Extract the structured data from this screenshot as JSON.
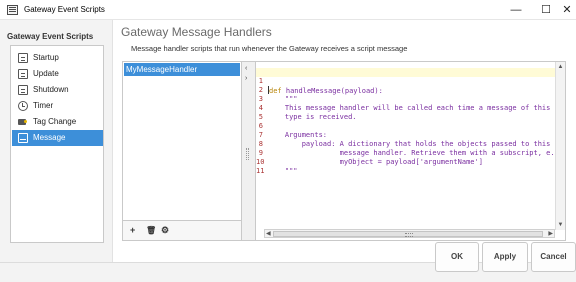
{
  "window": {
    "title": "Gateway Event Scripts",
    "minimize": "—",
    "maximize": "☐",
    "close": "✕"
  },
  "sidebar": {
    "heading": "Gateway Event Scripts",
    "items": [
      {
        "label": "Startup",
        "icon": "document-icon",
        "active": false
      },
      {
        "label": "Update",
        "icon": "document-icon",
        "active": false
      },
      {
        "label": "Shutdown",
        "icon": "document-icon",
        "active": false
      },
      {
        "label": "Timer",
        "icon": "clock-icon",
        "active": false
      },
      {
        "label": "Tag Change",
        "icon": "tag-icon",
        "active": false
      },
      {
        "label": "Message",
        "icon": "message-icon",
        "active": true
      }
    ]
  },
  "main": {
    "title": "Gateway Message Handlers",
    "description": "Message handler scripts that run whenever the Gateway receives a script message"
  },
  "handlers": {
    "items": [
      "MyMessageHandler"
    ],
    "toolbar": {
      "add": "+",
      "delete": "🗑",
      "settings": "⚙"
    }
  },
  "editor": {
    "lines": [
      {
        "n": "1",
        "keyword": "def",
        "text": " handleMessage(payload):"
      },
      {
        "n": "2",
        "keyword": "",
        "text": "    \"\"\""
      },
      {
        "n": "3",
        "keyword": "",
        "text": "    This message handler will be called each time a message of this"
      },
      {
        "n": "4",
        "keyword": "",
        "text": "    type is received."
      },
      {
        "n": "5",
        "keyword": "",
        "text": ""
      },
      {
        "n": "6",
        "keyword": "",
        "text": "    Arguments:"
      },
      {
        "n": "7",
        "keyword": "",
        "text": "        payload: A dictionary that holds the objects passed to this"
      },
      {
        "n": "8",
        "keyword": "",
        "text": "                 message handler. Retrieve them with a subscript, e.g."
      },
      {
        "n": "9",
        "keyword": "",
        "text": "                 myObject = payload['argumentName']"
      },
      {
        "n": "10",
        "keyword": "",
        "text": "    \"\"\""
      },
      {
        "n": "11",
        "keyword": "",
        "text": ""
      }
    ]
  },
  "buttons": {
    "ok": "OK",
    "apply": "Apply",
    "cancel": "Cancel"
  },
  "colors": {
    "selection": "#3d8fd9",
    "line_number": "#a33333",
    "code_text": "#7a2ea0",
    "keyword": "#b8860b",
    "current_line": "#fffbd6"
  }
}
